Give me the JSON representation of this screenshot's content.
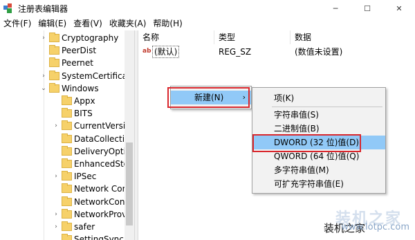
{
  "window": {
    "title": "注册表编辑器",
    "minimize_glyph": "─",
    "maximize_glyph": "☐",
    "close_glyph": "✕"
  },
  "menubar": {
    "items": [
      "文件(F)",
      "编辑(E)",
      "查看(V)",
      "收藏夹(A)",
      "帮助(H)"
    ]
  },
  "tree": {
    "collapsed_glyph": "›",
    "expanded_glyph": "⌄",
    "items": [
      {
        "label": "Cryptography",
        "expander": "collapsed"
      },
      {
        "label": "PeerDist",
        "expander": "none"
      },
      {
        "label": "Peernet",
        "expander": "none"
      },
      {
        "label": "SystemCertificate",
        "expander": "collapsed"
      },
      {
        "label": "Windows",
        "expander": "expanded"
      },
      {
        "label": "Appx",
        "expander": "none"
      },
      {
        "label": "BITS",
        "expander": "none"
      },
      {
        "label": "CurrentVersic",
        "expander": "collapsed"
      },
      {
        "label": "DataCollectio",
        "expander": "none"
      },
      {
        "label": "DeliveryOptin",
        "expander": "none"
      },
      {
        "label": "EnhancedStor",
        "expander": "none"
      },
      {
        "label": "IPSec",
        "expander": "collapsed"
      },
      {
        "label": "Network Con",
        "expander": "none"
      },
      {
        "label": "NetworkConn",
        "expander": "none"
      },
      {
        "label": "NetworkProv",
        "expander": "collapsed"
      },
      {
        "label": "safer",
        "expander": "collapsed"
      },
      {
        "label": "SettingSync",
        "expander": "none"
      }
    ]
  },
  "list": {
    "columns": {
      "name": "名称",
      "type": "类型",
      "data": "数据"
    },
    "rows": [
      {
        "icon": "ab",
        "name": "(默认)",
        "type": "REG_SZ",
        "data": "(数值未设置)"
      }
    ]
  },
  "context_menu": {
    "new_label": "新建(N)",
    "submenu_arrow": "›"
  },
  "submenu": {
    "items": [
      "项(K)",
      "字符串值(S)",
      "二进制值(B)",
      "DWORD (32 位)值(D)",
      "QWORD (64 位)值(Q)",
      "多字符串值(M)",
      "可扩充字符串值(E)"
    ],
    "highlighted_index": 3
  },
  "colors": {
    "highlight": "#91c9f7",
    "annotation_box": "#d9262c",
    "folder": "#f6d16a"
  },
  "watermark": {
    "text": "装机之家",
    "url": "www.lotpc.com",
    "big_text": "装机之家"
  }
}
